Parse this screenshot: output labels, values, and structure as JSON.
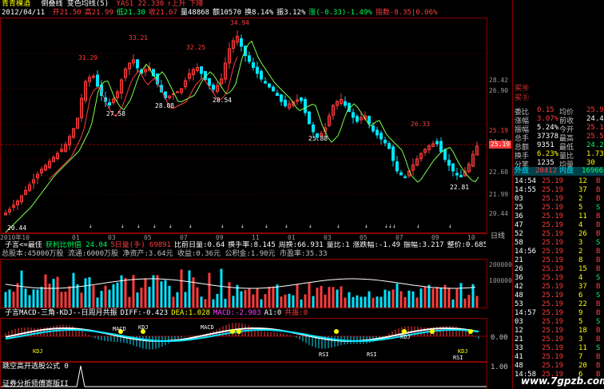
{
  "header": {
    "stock_name": "青青稞酒",
    "indicator": "倒叠线 变色均线(5)",
    "vars": [
      {
        "label": "YAS1 22.330",
        "color": "#ff3c3c"
      },
      {
        "label": "↑上升",
        "color": "#ff3c3c"
      },
      {
        "label": "下降",
        "color": "#ff3c3c"
      }
    ],
    "date": "2012/04/11",
    "ohlc": [
      {
        "label": "开21.50",
        "color": "#ff3c3c"
      },
      {
        "label": "高21.99",
        "color": "#ff3c3c"
      },
      {
        "label": "低21.30",
        "color": "#00ff5a"
      },
      {
        "label": "收21.67",
        "color": "#ff3c3c"
      },
      {
        "label": "量48868",
        "color": "#ffffff"
      },
      {
        "label": "额10570",
        "color": "#ffffff"
      },
      {
        "label": "换8.14%",
        "color": "#ffffff"
      },
      {
        "label": "振3.12%",
        "color": "#ffffff"
      },
      {
        "label": "涨(-0.33)-1.49%",
        "color": "#00ff5a"
      },
      {
        "label": "指数-8.35|0.06%",
        "color": "#ff3c3c"
      }
    ]
  },
  "main_chart": {
    "price_labels": [
      {
        "text": "33.21",
        "color": "#ff3c3c"
      },
      {
        "text": "34.94",
        "color": "#ff3c3c"
      },
      {
        "text": "31.29",
        "color": "#ff3c3c"
      },
      {
        "text": "32.25",
        "color": "#ff3c3c"
      },
      {
        "text": "27.58",
        "color": "#ffffff"
      },
      {
        "text": "28.08",
        "color": "#ffffff"
      },
      {
        "text": "28.54",
        "color": "#ffffff"
      },
      {
        "text": "25.88",
        "color": "#ffffff"
      },
      {
        "text": "26.33",
        "color": "#ff3c3c"
      },
      {
        "text": "22.81",
        "color": "#ffffff"
      },
      {
        "text": "20.44",
        "color": "#ffffff"
      }
    ],
    "right_axis": [
      "28.42",
      "26.90",
      "25.19",
      "24.00",
      "22.68",
      "21.99",
      "20.44"
    ],
    "current_price_tag": "25.19"
  },
  "date_axis": {
    "labels": [
      "2010年10",
      "",
      "01",
      "03",
      "05",
      "07",
      "09",
      "11",
      "01",
      "03",
      "05",
      "07",
      "09",
      "10"
    ],
    "right_label": "日线"
  },
  "info_bar": {
    "items": [
      {
        "label": "子言<=最佳",
        "color": "#ffffff"
      },
      {
        "label": "获利比例值 24.04",
        "color": "#00ff5a"
      },
      {
        "label": "5日量(手) 69891",
        "color": "#ff3c3c"
      },
      {
        "label": "比前日量:0.64",
        "color": "#ffffff"
      },
      {
        "label": "换手率:8.145",
        "color": "#ffffff"
      },
      {
        "label": "周换:66.931",
        "color": "#ffffff"
      },
      {
        "label": "量比:1",
        "color": "#ffffff"
      },
      {
        "label": "涨跌幅:-1.49",
        "color": "#ffffff"
      },
      {
        "label": "振幅:3.217",
        "color": "#ffffff"
      },
      {
        "label": "整价:0.685",
        "color": "#ffffff"
      },
      {
        "label": "五日换手:68.9",
        "color": "#ffff00"
      },
      {
        "label": "十日换手:142.5",
        "color": "#ffffff"
      }
    ],
    "line2": "总股本:45000万股 流通:6000万股 净资产:3.64元 收益:0.36元 公积金:1.90元 市盈率:35.33"
  },
  "volume_panel": {
    "right_axis": [
      "200000",
      "100000"
    ]
  },
  "macd_panel": {
    "title_items": [
      {
        "label": "子言MACD-三角-KDJ--日周月共振",
        "color": "#ffffff"
      },
      {
        "label": "DIFF:-0.423",
        "color": "#ffffff"
      },
      {
        "label": "DEA:1.028",
        "color": "#ffff00"
      },
      {
        "label": "MACD:-2.903",
        "color": "#ff40ff"
      },
      {
        "label": "A1:0",
        "color": "#ffffff"
      },
      {
        "label": "共振:0",
        "color": "#ff3c3c"
      }
    ],
    "annotations": [
      {
        "text": "KDJ",
        "color": "#ffff00"
      },
      {
        "text": "MACD",
        "color": "#ffffff"
      },
      {
        "text": "KDJ",
        "color": "#ffffff"
      },
      {
        "text": "MACD",
        "color": "#ffffff"
      },
      {
        "text": "RSI",
        "color": "#ffffff"
      },
      {
        "text": "RSI",
        "color": "#ffffff"
      },
      {
        "text": "KDJ",
        "color": "#ffffff"
      },
      {
        "text": "KDJ",
        "color": "#ffff00"
      },
      {
        "text": "RSI",
        "color": "#ffffff"
      }
    ],
    "right_axis": [
      "0.00"
    ]
  },
  "formula_panel": {
    "title": "跳空高开选股公式 0",
    "footer": "证券分析师傅寄版II",
    "right_axis": [
      "1.00",
      "0.00"
    ]
  },
  "quote": {
    "header_label": "买⑩",
    "sell_label": "买⑤",
    "rows": [
      {
        "k": "委比",
        "v": "0.15",
        "k2": "均价",
        "v2": "25.92",
        "vc": "#ff3c3c",
        "v2c": "#ff3c3c"
      },
      {
        "k": "涨幅",
        "v": "3.07%",
        "k2": "前收",
        "v2": "24.44",
        "vc": "#ff3c3c",
        "v2c": "#ffffff"
      },
      {
        "k": "振幅",
        "v": "5.24%",
        "k2": "今开",
        "v2": "25.16",
        "vc": "#ffffff",
        "v2c": "#ff3c3c"
      },
      {
        "k": "总手",
        "v": "37378",
        "k2": "最高",
        "v2": "25.58",
        "vc": "#ffffff",
        "v2c": "#ff3c3c"
      },
      {
        "k": "总额",
        "v": "9351",
        "k2": "最低",
        "v2": "24.24",
        "vc": "#ffffff",
        "v2c": "#00ff5a"
      },
      {
        "k": "换手",
        "v": "6.23%",
        "k2": "量比",
        "v2": "1.73",
        "vc": "#ffff00",
        "v2c": "#ffff00"
      },
      {
        "k": "分笔",
        "v": "1235",
        "k2": "均量",
        "v2": "30",
        "vc": "#ffffff",
        "v2c": "#ffff00"
      }
    ],
    "outer": {
      "label": "外盘",
      "value": "20412",
      "label2": "内盘",
      "value2": "16966"
    },
    "ticks": [
      {
        "t": "14:54",
        "p": "25.19",
        "v": "12",
        "s": "B"
      },
      {
        "t": "14:55",
        "p": "25.19",
        "v": "37",
        "s": "B"
      },
      {
        "t": "03",
        "p": "25.19",
        "v": "2",
        "s": "B"
      },
      {
        "t": "25",
        "p": "25.19",
        "v": "5",
        "s": "S"
      },
      {
        "t": "36",
        "p": "25.19",
        "v": "11",
        "s": "B"
      },
      {
        "t": "47",
        "p": "25.19",
        "v": "4",
        "s": "B"
      },
      {
        "t": "52",
        "p": "25.19",
        "v": "26",
        "s": "B"
      },
      {
        "t": "58",
        "p": "25.19",
        "v": "3",
        "s": "S"
      },
      {
        "t": "14:56",
        "p": "25.19",
        "v": "2",
        "s": "B"
      },
      {
        "t": "21",
        "p": "25.19",
        "v": "8",
        "s": "B"
      },
      {
        "t": "26",
        "p": "25.19",
        "v": "15",
        "s": "B"
      },
      {
        "t": "36",
        "p": "25.19",
        "v": "4",
        "s": "S"
      },
      {
        "t": "42",
        "p": "25.19",
        "v": "37",
        "s": "B"
      },
      {
        "t": "48",
        "p": "25.19",
        "v": "6",
        "s": "S"
      },
      {
        "t": "53",
        "p": "25.19",
        "v": "22",
        "s": "B"
      },
      {
        "t": "14:57",
        "p": "25.19",
        "v": "9",
        "s": "B"
      },
      {
        "t": "03",
        "p": "25.19",
        "v": "5",
        "s": "S"
      },
      {
        "t": "12",
        "p": "25.19",
        "v": "18",
        "s": "B"
      },
      {
        "t": "21",
        "p": "25.19",
        "v": "3",
        "s": "B"
      },
      {
        "t": "33",
        "p": "25.19",
        "v": "11",
        "s": "S"
      },
      {
        "t": "41",
        "p": "25.19",
        "v": "7",
        "s": "B"
      },
      {
        "t": "48",
        "p": "25.19",
        "v": "20",
        "s": "B"
      },
      {
        "t": "14:58",
        "p": "25.19",
        "v": "6",
        "s": "B"
      }
    ]
  },
  "watermark": "www.7gpzb.com"
}
